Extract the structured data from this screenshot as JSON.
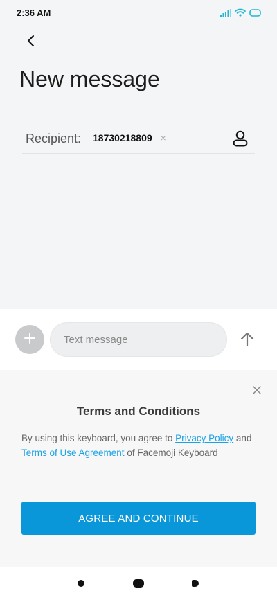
{
  "status_bar": {
    "time": "2:36 AM",
    "accent_color": "#1fb7d6"
  },
  "header": {
    "back_icon": "chevron-left-icon",
    "title": "New message"
  },
  "recipient": {
    "label": "Recipient:",
    "chip_number": "18730218809",
    "chip_remove": "×",
    "contact_icon": "person-icon"
  },
  "compose": {
    "attach_icon": "plus-icon",
    "placeholder": "Text message",
    "send_icon": "arrow-up-icon"
  },
  "terms": {
    "close_icon": "close-icon",
    "title": "Terms and Conditions",
    "text_prefix": "By using this keyboard, you agree to ",
    "privacy_link": "Privacy Policy",
    "text_and": " and ",
    "terms_link": "Terms of Use Agreement",
    "text_suffix": " of Facemoji Keyboard",
    "agree_button": "AGREE AND CONTINUE",
    "button_color": "#0a97d9",
    "link_color": "#1aa3e4"
  },
  "nav": {
    "back_icon": "back-dot-icon",
    "home_icon": "home-pill-icon",
    "recent_icon": "recent-icon"
  }
}
